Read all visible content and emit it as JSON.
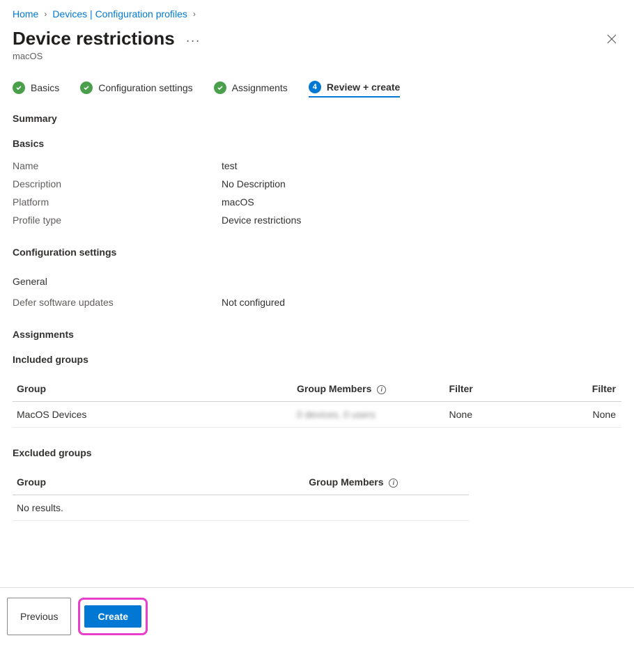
{
  "breadcrumb": {
    "home": "Home",
    "devices": "Devices | Configuration profiles"
  },
  "header": {
    "title": "Device restrictions",
    "subtitle": "macOS"
  },
  "steps": {
    "basics": "Basics",
    "config": "Configuration settings",
    "assignments": "Assignments",
    "review_num": "4",
    "review": "Review + create"
  },
  "summary": {
    "heading": "Summary",
    "basics_heading": "Basics",
    "name_key": "Name",
    "name_val": "test",
    "desc_key": "Description",
    "desc_val": "No Description",
    "platform_key": "Platform",
    "platform_val": "macOS",
    "profiletype_key": "Profile type",
    "profiletype_val": "Device restrictions"
  },
  "config_settings": {
    "heading": "Configuration settings",
    "general_heading": "General",
    "defer_key": "Defer software updates",
    "defer_val": "Not configured"
  },
  "assignments": {
    "heading": "Assignments",
    "included_heading": "Included groups",
    "excluded_heading": "Excluded groups",
    "col_group": "Group",
    "col_members": "Group Members",
    "col_filter": "Filter",
    "row_group": "MacOS Devices",
    "row_members": "0 devices, 0 users",
    "row_filter1": "None",
    "row_filter2": "None",
    "no_results": "No results."
  },
  "footer": {
    "previous": "Previous",
    "create": "Create"
  }
}
